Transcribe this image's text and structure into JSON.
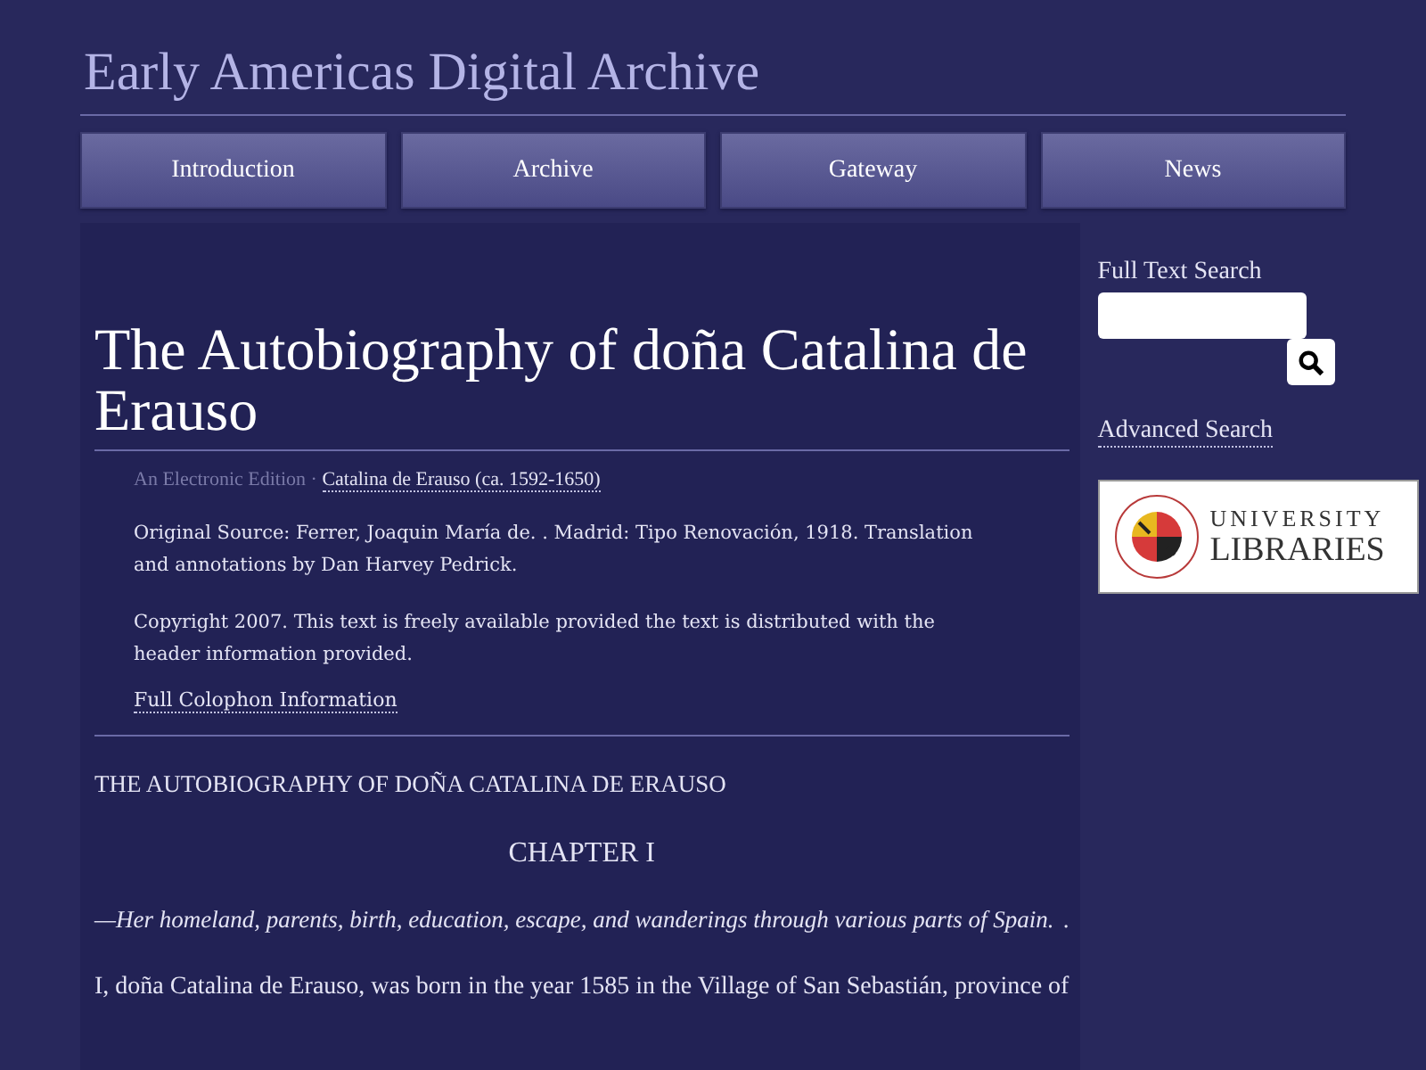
{
  "site_title": "Early Americas Digital Archive",
  "nav": [
    {
      "label": "Introduction"
    },
    {
      "label": "Archive"
    },
    {
      "label": "Gateway"
    },
    {
      "label": "News"
    }
  ],
  "main": {
    "title": "The Autobiography of doña Catalina de Erauso",
    "edition_label": "An Electronic Edition · ",
    "author_link": "Catalina de Erauso (ca. 1592-1650)",
    "source": "Original Source: Ferrer, Joaquin María de. . Madrid: Tipo Renovación, 1918. Translation and annotations by Dan Harvey Pedrick.",
    "copyright": "Copyright 2007. This text is freely available provided the text is distributed with the header information provided.",
    "colophon_link": "Full Colophon Information",
    "book_heading": "THE AUTOBIOGRAPHY OF DOÑA CATALINA DE ERAUSO",
    "chapter": "CHAPTER I",
    "summary": "—Her homeland, parents, birth, education, escape, and wanderings through various parts of Spain.",
    "summary_mark": ".",
    "body": "I, doña Catalina de Erauso, was born in the year 1585 in the Village of San Sebastián, province of"
  },
  "sidebar": {
    "search_label": "Full Text Search",
    "advanced_link": "Advanced Search",
    "logo_line_1": "UNIVERSITY",
    "logo_line_2": "LIBRARIES"
  }
}
